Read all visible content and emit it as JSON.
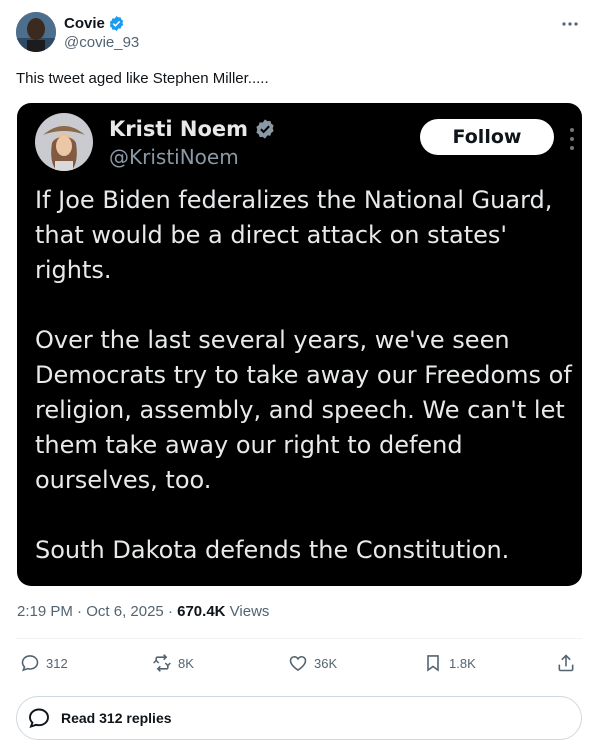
{
  "author": {
    "display_name": "Covie",
    "handle": "@covie_93",
    "verified": true
  },
  "tweet": {
    "text": "This tweet aged like Stephen Miller.....",
    "time": "2:19 PM",
    "separator": "·",
    "date": "Oct 6, 2025",
    "views_count": "670.4K",
    "views_label": "Views"
  },
  "quoted": {
    "display_name": "Kristi Noem",
    "handle": "@KristiNoem",
    "follow_label": "Follow",
    "paragraphs": [
      "If Joe Biden federalizes the National Guard, that would be a direct attack on states' rights.",
      "Over the last several years, we've seen Democrats try to take away our Freedoms of religion, assembly, and speech. We can't let them take away our right to defend ourselves, too.",
      "South Dakota defends the Constitution."
    ]
  },
  "actions": {
    "replies": "312",
    "reposts": "8K",
    "likes": "36K",
    "bookmarks": "1.8K"
  },
  "read_replies_label": "Read 312 replies",
  "icons": [
    "verified-badge-icon",
    "more-icon",
    "reply-icon",
    "repost-icon",
    "like-icon",
    "bookmark-icon",
    "share-icon",
    "speech-bubble-icon"
  ],
  "colors": {
    "verified": "#1d9bf0",
    "secondary_text": "#536471",
    "quote_bg": "#000000",
    "quote_text": "#e7e9ea"
  }
}
